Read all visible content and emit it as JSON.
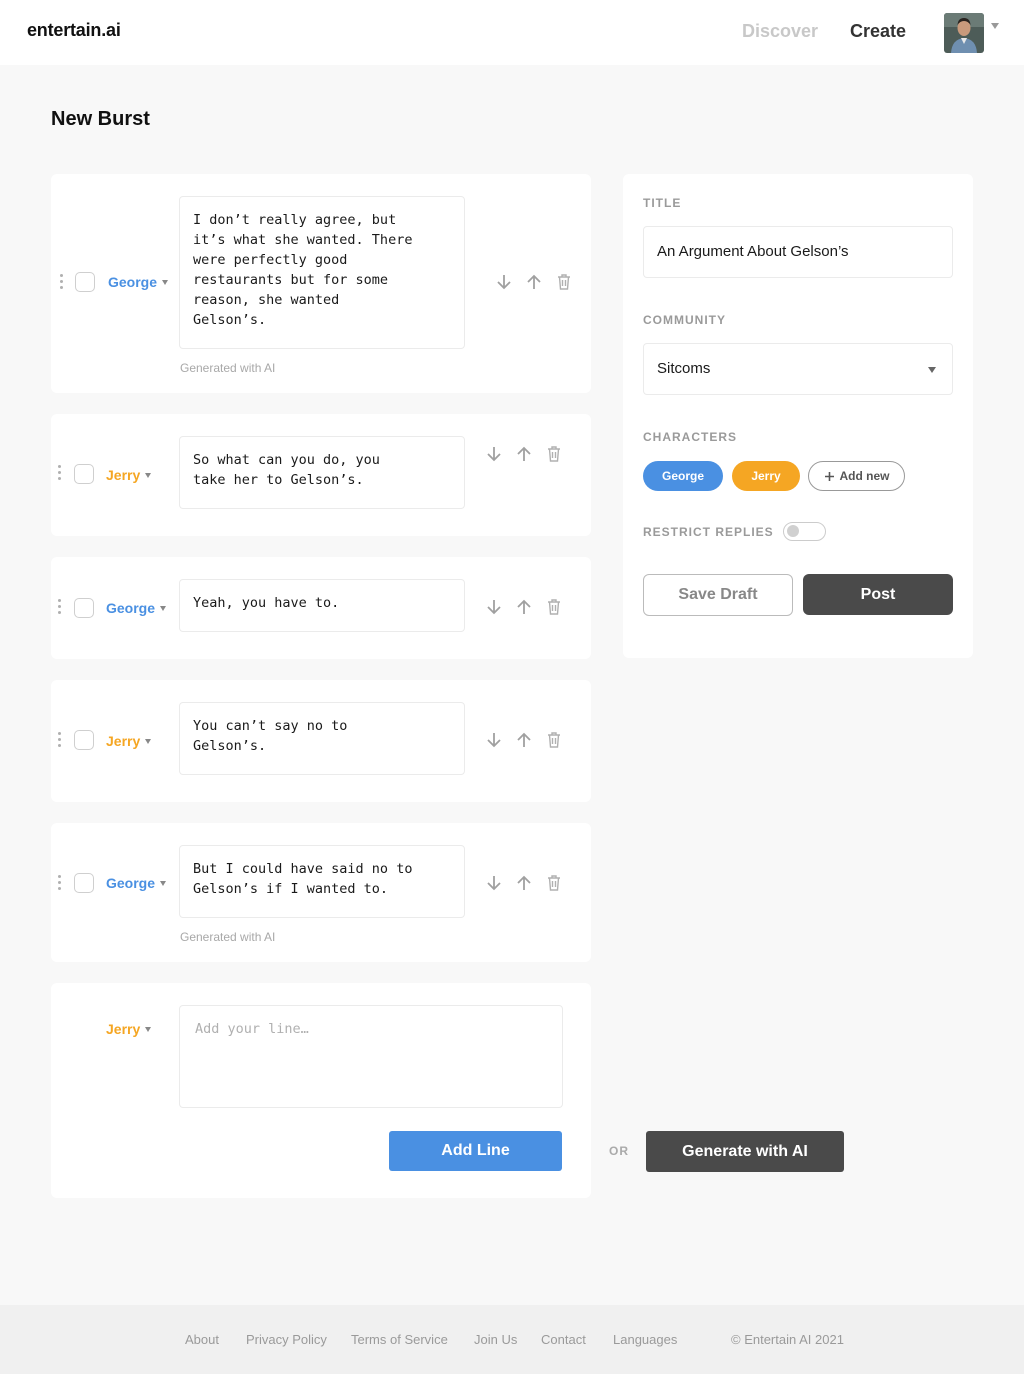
{
  "header": {
    "logo": "entertain.ai",
    "nav": {
      "discover": "Discover",
      "create": "Create"
    }
  },
  "page": {
    "title": "New Burst"
  },
  "lines": [
    {
      "speaker": "George",
      "speaker_color": "#4a90e2",
      "text": "I don’t really agree, but\nit’s what she wanted. There\nwere perfectly good\nrestaurants but for some\nreason, she wanted\nGelson’s.",
      "note": "Generated with AI"
    },
    {
      "speaker": "Jerry",
      "speaker_color": "#f5a623",
      "text": "So what can you do, you\ntake her to Gelson’s."
    },
    {
      "speaker": "George",
      "speaker_color": "#4a90e2",
      "text": "Yeah, you have to."
    },
    {
      "speaker": "Jerry",
      "speaker_color": "#f5a623",
      "text": "You can’t say no to\nGelson’s."
    },
    {
      "speaker": "George",
      "speaker_color": "#4a90e2",
      "text": "But I could have said no to\nGelson’s if I wanted to.",
      "note": "Generated with AI"
    }
  ],
  "new_line": {
    "speaker": "Jerry",
    "placeholder": "Add your line…",
    "add_label": "Add Line",
    "or_label": "OR",
    "generate_label": "Generate with AI"
  },
  "sidebar": {
    "title_label": "TITLE",
    "title_value": "An Argument About Gelson’s",
    "community_label": "COMMUNITY",
    "community_value": "Sitcoms",
    "characters_label": "CHARACTERS",
    "characters": [
      {
        "name": "George",
        "color": "#4a90e2"
      },
      {
        "name": "Jerry",
        "color": "#f5a623"
      }
    ],
    "add_new_label": "Add new",
    "restrict_label": "RESTRICT REPLIES",
    "restrict_on": false,
    "save_draft_label": "Save Draft",
    "post_label": "Post"
  },
  "footer": {
    "links": [
      "About",
      "Privacy Policy",
      "Terms of Service",
      "Join Us",
      "Contact",
      "Languages"
    ],
    "copyright": "© Entertain AI 2021"
  }
}
